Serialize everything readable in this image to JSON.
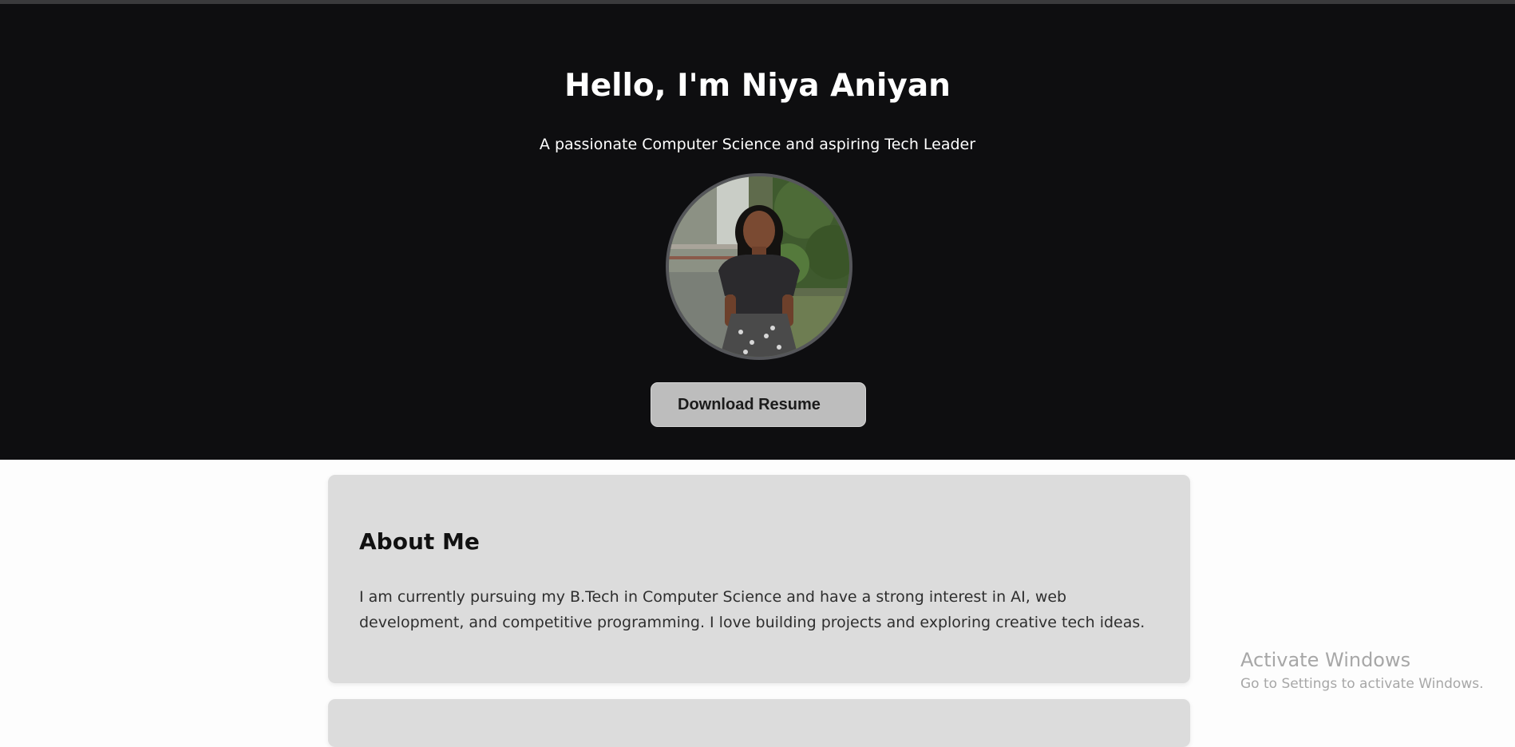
{
  "hero": {
    "title": "Hello, I'm Niya Aniyan",
    "subtitle": "A passionate Computer Science and aspiring Tech Leader",
    "resume_button": "Download Resume"
  },
  "about": {
    "heading": "About Me",
    "text": "I am currently pursuing my B.Tech in Computer Science and have a strong interest in AI, web development, and competitive programming. I love building projects and exploring creative tech ideas."
  },
  "watermark": {
    "title": "Activate Windows",
    "subtitle": "Go to Settings to activate Windows."
  },
  "colors": {
    "hero_background": "#0e0e10",
    "page_background": "#fdfdfd",
    "card_background": "#dcdcdc",
    "button_background": "#bdbdbd"
  }
}
